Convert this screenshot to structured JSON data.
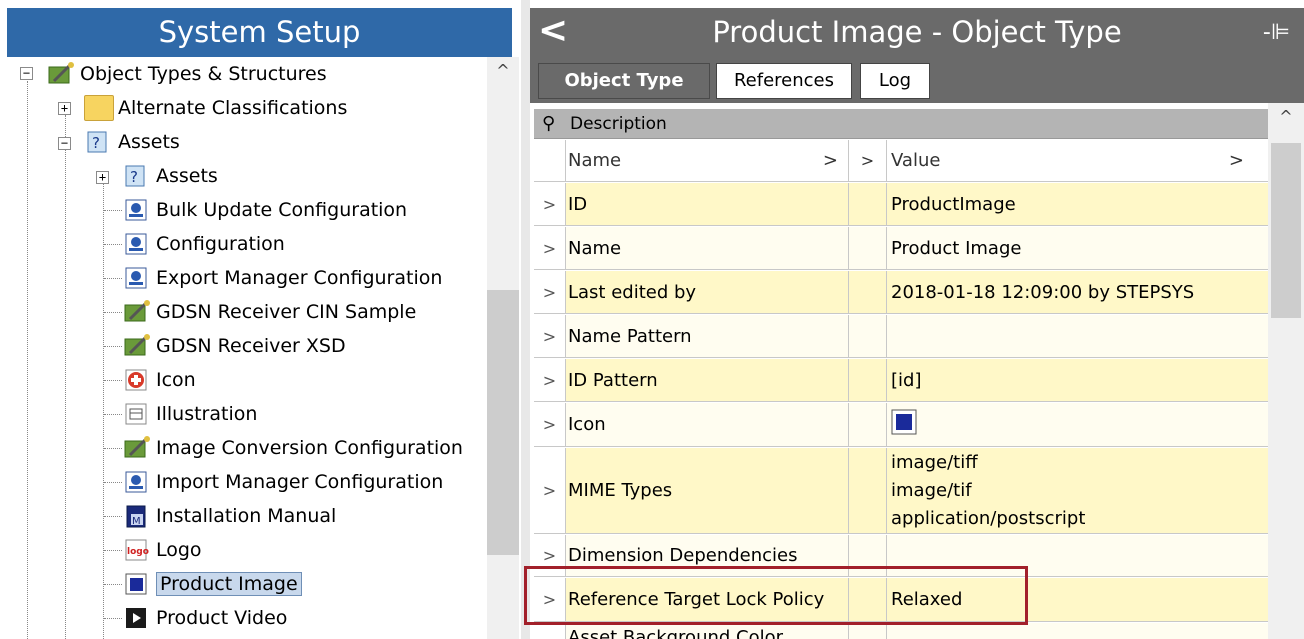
{
  "left_panel": {
    "title": "System Setup",
    "tree": [
      {
        "label": "Object Types & Structures",
        "icon": "wizard-icon",
        "expander": "−"
      },
      {
        "label": "Alternate Classifications",
        "icon": "folder-icon",
        "expander": "+"
      },
      {
        "label": "Assets",
        "icon": "asset-type-icon",
        "expander": "−"
      },
      {
        "label": "Assets",
        "icon": "asset-type-icon",
        "expander": "+"
      },
      {
        "label": "Bulk Update Configuration",
        "icon": "config-icon"
      },
      {
        "label": "Configuration",
        "icon": "config-icon"
      },
      {
        "label": "Export Manager Configuration",
        "icon": "config-icon"
      },
      {
        "label": "GDSN Receiver CIN Sample",
        "icon": "wizard-icon"
      },
      {
        "label": "GDSN Receiver XSD",
        "icon": "wizard-icon"
      },
      {
        "label": "Icon",
        "icon": "red-cross-icon"
      },
      {
        "label": "Illustration",
        "icon": "illustration-icon"
      },
      {
        "label": "Image Conversion Configuration",
        "icon": "wizard-icon"
      },
      {
        "label": "Import Manager Configuration",
        "icon": "config-icon"
      },
      {
        "label": "Installation Manual",
        "icon": "manual-icon"
      },
      {
        "label": "Logo",
        "icon": "logo-icon"
      },
      {
        "label": "Product Image",
        "icon": "product-image-icon",
        "selected": true
      },
      {
        "label": "Product Video",
        "icon": "video-icon"
      }
    ],
    "scroll_up": "^"
  },
  "right_panel": {
    "back_glyph": "<",
    "title": "Product Image - Object Type",
    "pin_glyph": "-⊫",
    "tabs": [
      {
        "label": "Object Type",
        "active": true
      },
      {
        "label": "References"
      },
      {
        "label": "Log"
      }
    ],
    "section": "Description",
    "columns": {
      "name": "Name",
      "value": "Value",
      "arrow": ">"
    },
    "rows": [
      {
        "name": "ID",
        "value": "ProductImage"
      },
      {
        "name": "Name",
        "value": "Product Image"
      },
      {
        "name": "Last edited by",
        "value": "2018-01-18 12:09:00 by STEPSYS"
      },
      {
        "name": "Name Pattern",
        "value": ""
      },
      {
        "name": "ID Pattern",
        "value": "[id]"
      },
      {
        "name": "Icon",
        "value": ""
      },
      {
        "name": "MIME Types",
        "values": [
          "image/tiff",
          "image/tif",
          "application/postscript"
        ]
      },
      {
        "name": "Dimension Dependencies",
        "value": ""
      },
      {
        "name": "Reference Target Lock Policy",
        "value": "Relaxed"
      },
      {
        "name": "Asset Background Color",
        "value": ""
      }
    ],
    "scroll_up": "^",
    "highlight_color": "#a2202a"
  }
}
